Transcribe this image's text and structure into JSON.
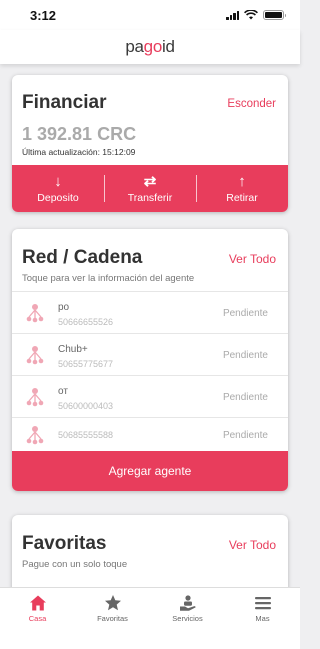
{
  "status_bar": {
    "time": "3:12"
  },
  "header": {
    "logo_pa": "pa",
    "logo_go": "go",
    "logo_id": "id"
  },
  "financiar": {
    "title": "Financiar",
    "hide_label": "Esconder",
    "balance": "1 392.81 CRC",
    "last_update": "Última actualización: 15:12:09",
    "actions": [
      {
        "label": "Deposito",
        "icon": "arrow-down-icon",
        "glyph": "↓"
      },
      {
        "label": "Transferir",
        "icon": "transfer-arrows-icon",
        "glyph": "⇄"
      },
      {
        "label": "Retirar",
        "icon": "arrow-up-icon",
        "glyph": "↑"
      }
    ]
  },
  "red": {
    "title": "Red / Cadena",
    "view_all": "Ver Todo",
    "subtitle": "Toque para ver la información del agente",
    "agents": [
      {
        "name": "po",
        "phone": "50666655526",
        "status": "Pendiente"
      },
      {
        "name": "Chub+",
        "phone": "50655775677",
        "status": "Pendiente"
      },
      {
        "name": "от",
        "phone": "50600000403",
        "status": "Pendiente"
      },
      {
        "name": "",
        "phone": "50685555588",
        "status": "Pendiente"
      }
    ],
    "add_agent_label": "Agregar agente"
  },
  "favoritas": {
    "title": "Favoritas",
    "view_all": "Ver Todo",
    "subtitle": "Pague con un solo toque"
  },
  "tabs": [
    {
      "label": "Casa",
      "icon": "home-icon",
      "active": true
    },
    {
      "label": "Favoritas",
      "icon": "star-icon",
      "active": false
    },
    {
      "label": "Servicios",
      "icon": "hand-service-icon",
      "active": false
    },
    {
      "label": "Mas",
      "icon": "menu-icon",
      "active": false
    }
  ],
  "colors": {
    "accent": "#e83d5c",
    "background": "#efeff1",
    "text": "#333333"
  }
}
